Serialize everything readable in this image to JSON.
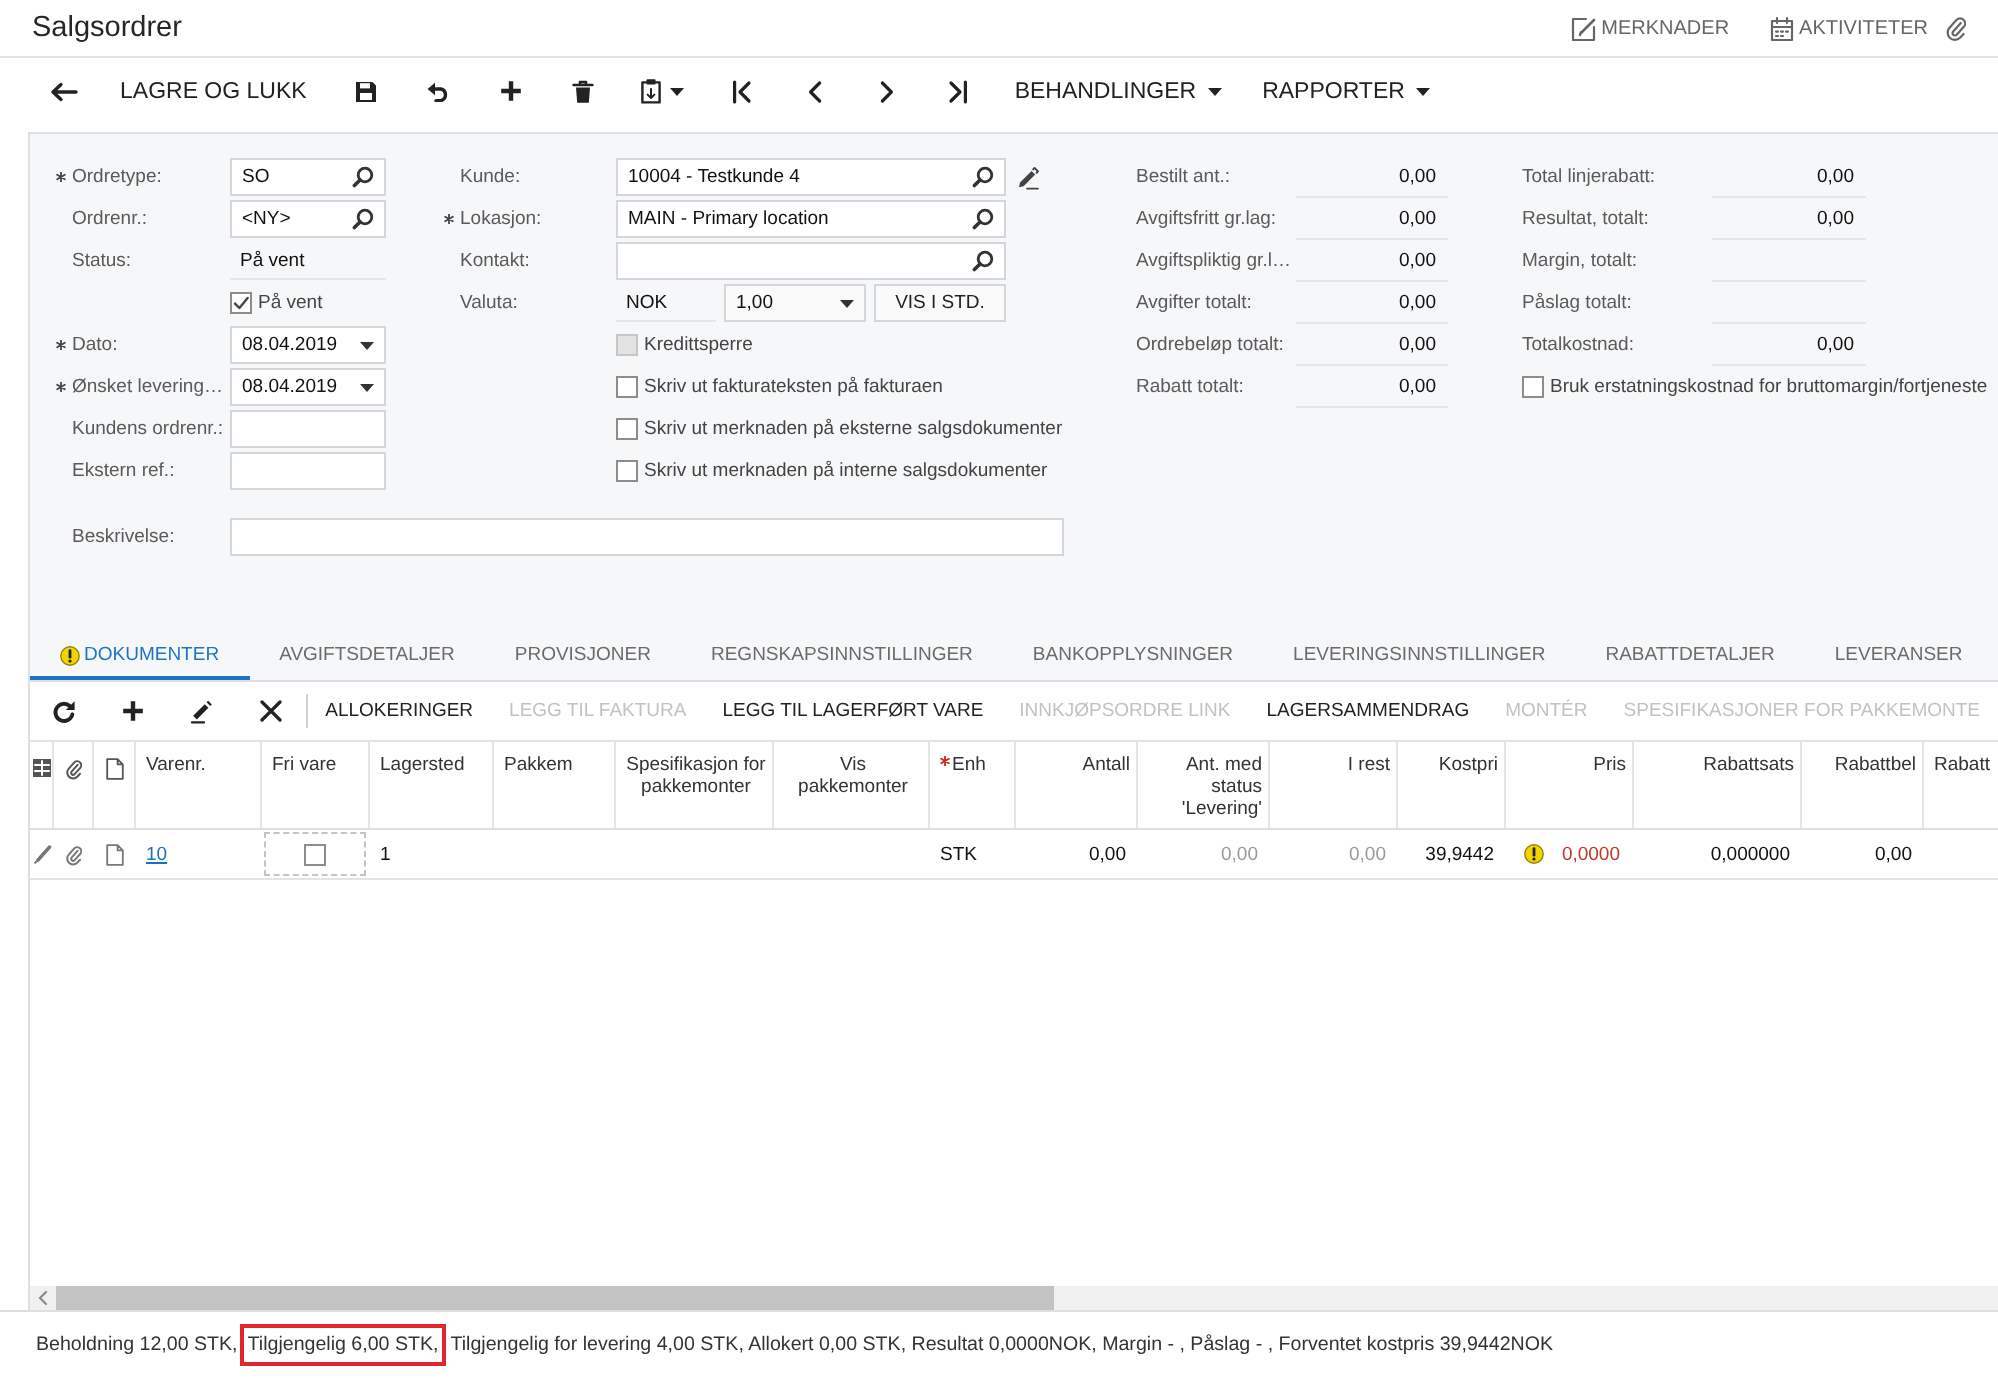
{
  "window": {
    "title": "Salgsordrer"
  },
  "header_actions": [
    {
      "label": "MERKNADER"
    },
    {
      "label": "AKTIVITETER"
    }
  ],
  "toolbar": {
    "save_close": "LAGRE OG LUKK",
    "menus": [
      {
        "label": "BEHANDLINGER"
      },
      {
        "label": "RAPPORTER"
      }
    ]
  },
  "form": {
    "column_1": [
      {
        "kind": "lookup",
        "label": "Ordretype:",
        "required": true,
        "value": "SO"
      },
      {
        "kind": "lookup",
        "label": "Ordrenr.:",
        "required": false,
        "value": "<NY>"
      },
      {
        "kind": "readonly",
        "label": "Status:",
        "required": false,
        "value": "På vent"
      },
      {
        "kind": "checkbox",
        "label": "På vent",
        "required": false,
        "checked": true
      },
      {
        "kind": "date",
        "label": "Dato:",
        "required": true,
        "value": "08.04.2019"
      },
      {
        "kind": "date",
        "label": "Ønsket levering…",
        "required": true,
        "value": "08.04.2019"
      },
      {
        "kind": "input",
        "label": "Kundens ordrenr.:",
        "required": false
      },
      {
        "kind": "input",
        "label": "Ekstern ref.:",
        "required": false
      }
    ],
    "column_2": [
      {
        "kind": "editlookup",
        "label": "Kunde:",
        "required": false,
        "value": "10004 - Testkunde 4"
      },
      {
        "kind": "lookup",
        "label": "Lokasjon:",
        "required": true,
        "value": "MAIN - Primary location"
      },
      {
        "kind": "lookup",
        "label": "Kontakt:",
        "required": false
      },
      {
        "kind": "currency",
        "label": "Valuta:",
        "required": false,
        "value": "NOK",
        "rate": "1,00",
        "button": "VIS I STD."
      }
    ],
    "options": [
      {
        "label": "Kredittsperre",
        "checked": false,
        "disabled": true
      },
      {
        "label": "Skriv ut fakturateksten på fakturaen",
        "checked": false,
        "disabled": false
      },
      {
        "label": "Skriv ut merknaden på eksterne salgsdokumenter",
        "checked": false,
        "disabled": false
      },
      {
        "label": "Skriv ut merknaden på interne salgsdokumenter",
        "checked": false,
        "disabled": false
      }
    ],
    "description": {
      "label": "Beskrivelse:"
    },
    "totals_1": [
      {
        "label": "Bestilt ant.:",
        "value": "0,00"
      },
      {
        "label": "Avgiftsfritt gr.lag:",
        "value": "0,00"
      },
      {
        "label": "Avgiftspliktig gr.l…",
        "value": "0,00"
      },
      {
        "label": "Avgifter totalt:",
        "value": "0,00"
      },
      {
        "label": "Ordrebeløp totalt:",
        "value": "0,00"
      },
      {
        "label": "Rabatt totalt:",
        "value": "0,00"
      }
    ],
    "totals_2": [
      {
        "label": "Total linjerabatt:",
        "value": "0,00"
      },
      {
        "label": "Resultat, totalt:",
        "value": "0,00"
      },
      {
        "label": "Margin, totalt:"
      },
      {
        "label": "Påslag totalt:"
      },
      {
        "label": "Totalkostnad:",
        "value": "0,00"
      }
    ],
    "totals_option": {
      "label": "Bruk erstatningskostnad for bruttomargin/fortjeneste",
      "checked": false
    }
  },
  "tabs": [
    {
      "label": "DOKUMENTER",
      "selected": true,
      "warning": true
    },
    {
      "label": "AVGIFTSDETALJER",
      "selected": false,
      "warning": false
    },
    {
      "label": "PROVISJONER",
      "selected": false,
      "warning": false
    },
    {
      "label": "REGNSKAPSINNSTILLINGER",
      "selected": false,
      "warning": false
    },
    {
      "label": "BANKOPPLYSNINGER",
      "selected": false,
      "warning": false
    },
    {
      "label": "LEVERINGSINNSTILLINGER",
      "selected": false,
      "warning": false
    },
    {
      "label": "RABATTDETALJER",
      "selected": false,
      "warning": false
    },
    {
      "label": "LEVERANSER",
      "selected": false,
      "warning": false
    }
  ],
  "grid_toolbar": {
    "buttons": [
      {
        "label": "ALLOKERINGER",
        "disabled": false
      },
      {
        "label": "LEGG TIL FAKTURA",
        "disabled": true
      },
      {
        "label": "LEGG TIL LAGERFØRT VARE",
        "disabled": false
      },
      {
        "label": "INNKJØPSORDRE LINK",
        "disabled": true
      },
      {
        "label": "LAGERSAMMENDRAG",
        "disabled": false
      },
      {
        "label": "MONTÉR",
        "disabled": true
      },
      {
        "label": "SPESIFIKASJONER FOR PAKKEMONTE",
        "disabled": true
      }
    ]
  },
  "table": {
    "columns": [
      {
        "label": "Varenr.",
        "required": false
      },
      {
        "label": "Fri vare",
        "required": false
      },
      {
        "label": "Lagersted",
        "required": false
      },
      {
        "label": "Pakkem",
        "required": false
      },
      {
        "label": "Spesifikasjon for pakkemonter",
        "required": false
      },
      {
        "label": "Vis pakkemonter",
        "required": false
      },
      {
        "label": "Enh",
        "required": true
      },
      {
        "label": "Antall",
        "required": false
      },
      {
        "label": "Ant. med status 'Levering'",
        "required": false
      },
      {
        "label": "I rest",
        "required": false
      },
      {
        "label": "Kostpri",
        "required": false
      },
      {
        "label": "Pris",
        "required": false
      },
      {
        "label": "Rabattsats",
        "required": false
      },
      {
        "label": "Rabattbel",
        "required": false
      },
      {
        "label": "Rabatt",
        "required": false
      }
    ],
    "rows": [
      {
        "cells": [
          {
            "kind": "link",
            "text": "10"
          },
          {
            "kind": "checkbox",
            "checked": false
          },
          {
            "kind": "text",
            "text": "1"
          },
          {
            "kind": "text"
          },
          {
            "kind": "text"
          },
          {
            "kind": "text"
          },
          {
            "kind": "text",
            "text": "STK"
          },
          {
            "kind": "number",
            "text": "0,00"
          },
          {
            "kind": "readonly",
            "text": "0,00"
          },
          {
            "kind": "readonly",
            "text": "0,00"
          },
          {
            "kind": "number",
            "text": "39,9442"
          },
          {
            "kind": "warning",
            "text": "0,0000"
          },
          {
            "kind": "number",
            "text": "0,000000"
          },
          {
            "kind": "number",
            "text": "0,00"
          },
          {
            "kind": "text"
          }
        ]
      }
    ]
  },
  "status_bar": {
    "segments": [
      {
        "text": "Beholdning 12,00 STK,",
        "highlighted": false
      },
      {
        "text": "Tilgjengelig 6,00 STK,",
        "highlighted": true
      },
      {
        "text": "Tilgjengelig for levering 4,00 STK, Allokert 0,00 STK, Resultat 0,0000NOK, Margin - , Påslag - , Forventet kostpris 39,9442NOK",
        "highlighted": false
      }
    ]
  }
}
